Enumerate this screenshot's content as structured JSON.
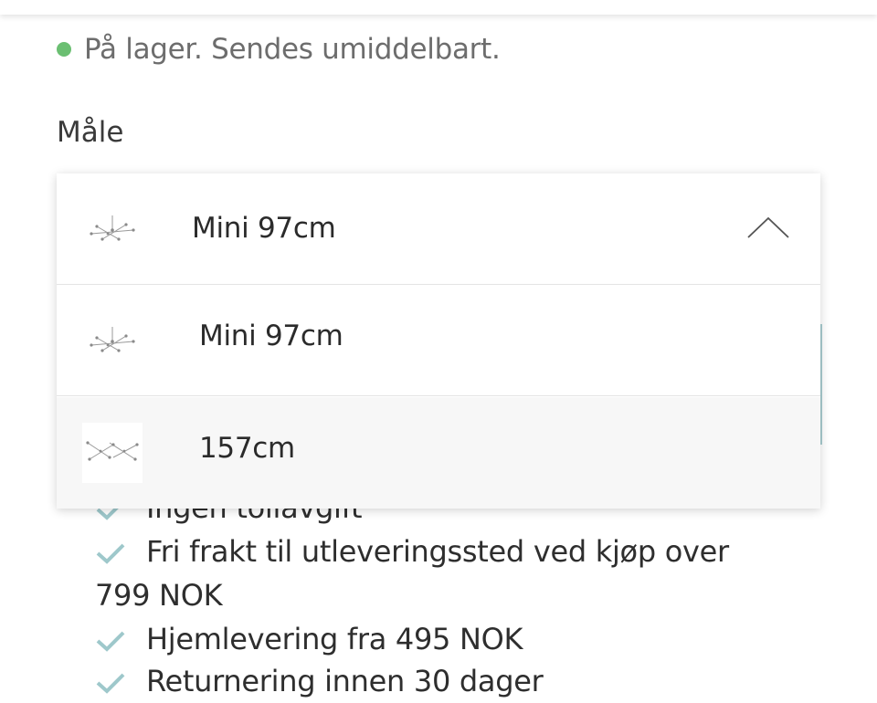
{
  "stock": {
    "text": "På lager. Sendes umiddelbart.",
    "dot_color": "#6bbf72"
  },
  "size": {
    "label": "Måle",
    "selected": "Mini 97cm",
    "options": [
      {
        "label": "Mini 97cm",
        "thumb": "chandelier-mini-thumbnail"
      },
      {
        "label": "157cm",
        "thumb": "chandelier-large-thumbnail"
      }
    ]
  },
  "features": [
    "Ingen tollavgift",
    "Fri frakt til utleveringssted ved kjøp over 799 NOK",
    "Hjemlevering fra 495 NOK",
    "Returnering innen 30 dager"
  ],
  "colors": {
    "check": "#9ec8cb",
    "accent": "#a9cdd0",
    "selected_option_bg": "#f7f7f7"
  }
}
